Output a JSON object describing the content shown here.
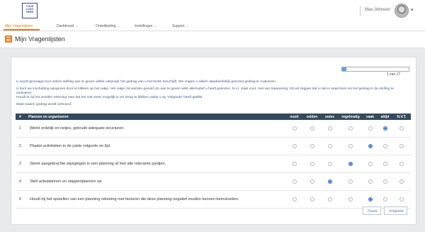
{
  "header": {
    "logo_text": "YOUR LOGO HERE",
    "user_name": "Max Johnson"
  },
  "nav": {
    "items": [
      "Mijn Vragenlijsten",
      "Dashboard",
      "Ontwikkeling",
      "Instellingen",
      "Support"
    ],
    "active": "Mijn Vragenlijsten",
    "accent_color": "#e8781e"
  },
  "page": {
    "title": "Mijn Vragenlijsten"
  },
  "progress": {
    "label": "1 van 17",
    "fraction": 0.06
  },
  "intro": {
    "p1": "U wordt gevraagd voor iedere stelling aan te geven welke uitspraak het gedrag van u het beste beschrijft. We vragen u alleen daadwerkelijk getoond gedrag te evalueren.",
    "p2": "U kunt uw inschatting aangeven door te klikken op het vakje. Het vakje zal worden gevuld om aan te geven welk alternatief u heeft gekozen. N.v.t. staat voor: niet van toepassing. Dit wil zeggen dat u niet in staat bent om het gedrag in de stelling te evalueren.",
    "p3": "Houdt er bij het invullen rekening mee dat het niet meer mogelijk is om terug te klikken nadat u op 'Volgende' heeft geklikt.",
    "p4": "Mate waarin gedrag wordt vertoond:"
  },
  "table": {
    "num_header": "#",
    "section_header": "Plannen en organiseren",
    "options": [
      "nooit",
      "zelden",
      "soms",
      "regelmatig",
      "vaak",
      "altijd",
      "N.V.T."
    ],
    "rows": [
      {
        "num": "1",
        "statement": "Werkt ordelijk en netjes, gebruikt adequate structuren.",
        "selected": "altijd"
      },
      {
        "num": "2",
        "statement": "Plaatst activiteiten in de juiste volgorde en tijd.",
        "selected": "vaak"
      },
      {
        "num": "3",
        "statement": "Stemt aangebrachte wijzigingen in een planning af met alle relevante partijen.",
        "selected": "regelmatig"
      },
      {
        "num": "4",
        "statement": "Stelt actieplannen en stappenplannen op.",
        "selected": "soms"
      },
      {
        "num": "5",
        "statement": "Houdt bij het opstellen van een planning rekening met factoren die deze planning negatief zouden kunnen beïnvloeden.",
        "selected": "vaak"
      }
    ]
  },
  "buttons": {
    "pause": "Pauze",
    "next": "Volgende"
  }
}
